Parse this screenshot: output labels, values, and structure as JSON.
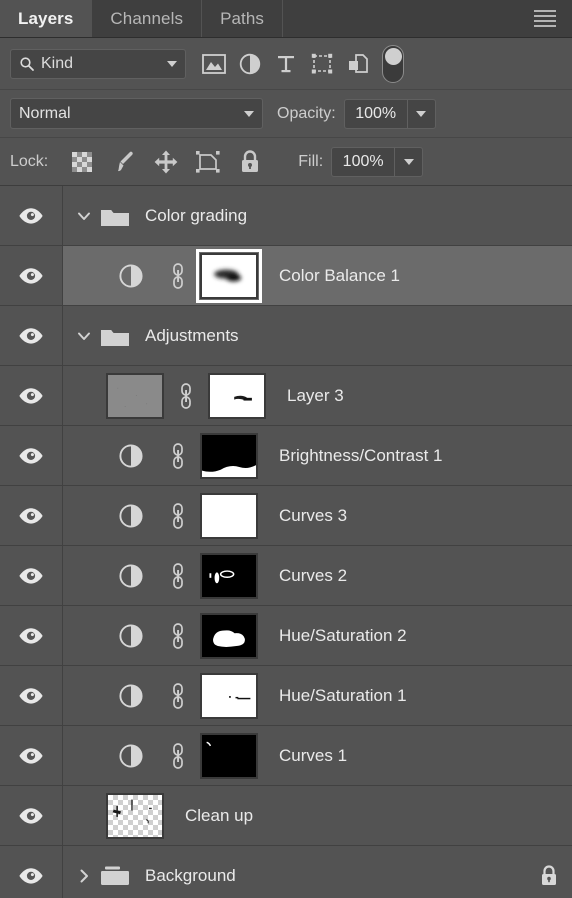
{
  "tabs": [
    {
      "label": "Layers",
      "active": true
    },
    {
      "label": "Channels",
      "active": false
    },
    {
      "label": "Paths",
      "active": false
    }
  ],
  "panel_menu_name": "panel-menu-icon",
  "filter": {
    "kind_label": "Kind",
    "search_icon": "search-icon",
    "icons": [
      "pixel-layer-filter-icon",
      "adjustment-layer-filter-icon",
      "type-layer-filter-icon",
      "shape-layer-filter-icon",
      "smart-object-filter-icon",
      "filter-toggle-switch"
    ]
  },
  "blend": {
    "mode": "Normal",
    "opacity_label": "Opacity:",
    "opacity_value": "100%"
  },
  "lock": {
    "label": "Lock:",
    "icons": [
      "lock-transparent-pixels-icon",
      "lock-image-pixels-icon",
      "lock-position-icon",
      "lock-artboard-nesting-icon",
      "lock-all-icon"
    ],
    "fill_label": "Fill:",
    "fill_value": "100%"
  },
  "layers": [
    {
      "name": "Color grading",
      "type": "group",
      "expanded": true,
      "visible": true,
      "selected": false,
      "locked": false
    },
    {
      "name": "Color Balance 1",
      "type": "adjustment",
      "visible": true,
      "selected": true,
      "mask_active": true,
      "mask": "blurred-dark-blob-on-white",
      "locked": false
    },
    {
      "name": "Adjustments",
      "type": "group",
      "expanded": true,
      "visible": true,
      "selected": false,
      "locked": false
    },
    {
      "name": "Layer 3",
      "type": "pixel",
      "visible": true,
      "selected": false,
      "thumb": "flat-gray-noise",
      "mask": "white-with-small-dark-stroke",
      "locked": false
    },
    {
      "name": "Brightness/Contrast 1",
      "type": "adjustment",
      "visible": true,
      "selected": false,
      "mask": "black-top-white-bottom",
      "locked": false
    },
    {
      "name": "Curves 3",
      "type": "adjustment",
      "visible": true,
      "selected": false,
      "mask": "all-white",
      "locked": false
    },
    {
      "name": "Curves 2",
      "type": "adjustment",
      "visible": true,
      "selected": false,
      "mask": "black-with-small-white-marks",
      "locked": false
    },
    {
      "name": "Hue/Saturation 2",
      "type": "adjustment",
      "visible": true,
      "selected": false,
      "mask": "black-with-white-blob",
      "locked": false
    },
    {
      "name": "Hue/Saturation 1",
      "type": "adjustment",
      "visible": true,
      "selected": false,
      "mask": "white-with-small-dark-marks",
      "locked": false
    },
    {
      "name": "Curves 1",
      "type": "adjustment",
      "visible": true,
      "selected": false,
      "mask": "black-with-tiny-white-mark",
      "locked": false
    },
    {
      "name": "Clean up",
      "type": "pixel",
      "visible": true,
      "selected": false,
      "thumb": "transparent-checkerboard-with-marks",
      "locked": false
    },
    {
      "name": "Background",
      "type": "group",
      "expanded": false,
      "visible": true,
      "selected": false,
      "locked": true
    }
  ],
  "colors": {
    "panel_bg": "#535353",
    "tab_inactive_bg": "#3f3f3f",
    "row_bg": "#535353",
    "row_selected_bg": "#6b6b6b",
    "gutter_bg": "#474747",
    "text": "#eaeaea",
    "icon": "#d0d0d0"
  }
}
